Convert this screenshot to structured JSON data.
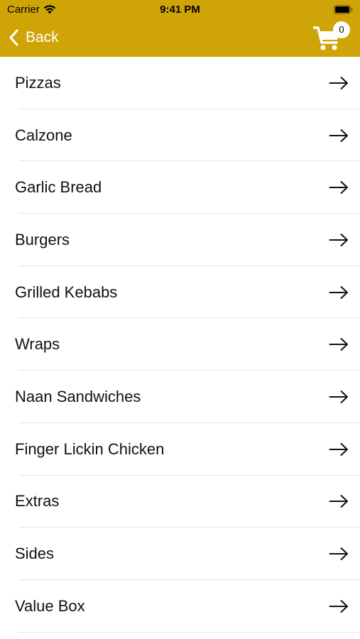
{
  "status_bar": {
    "carrier": "Carrier",
    "time": "9:41 PM"
  },
  "nav": {
    "back_label": "Back",
    "cart_count": "0"
  },
  "colors": {
    "header": "#cfa406",
    "text": "#111111",
    "divider": "#e4e4e4"
  },
  "menu": {
    "items": [
      {
        "label": "Pizzas"
      },
      {
        "label": "Calzone"
      },
      {
        "label": "Garlic Bread"
      },
      {
        "label": "Burgers"
      },
      {
        "label": "Grilled Kebabs"
      },
      {
        "label": "Wraps"
      },
      {
        "label": "Naan Sandwiches"
      },
      {
        "label": "Finger Lickin Chicken"
      },
      {
        "label": "Extras"
      },
      {
        "label": "Sides"
      },
      {
        "label": "Value Box"
      }
    ]
  }
}
